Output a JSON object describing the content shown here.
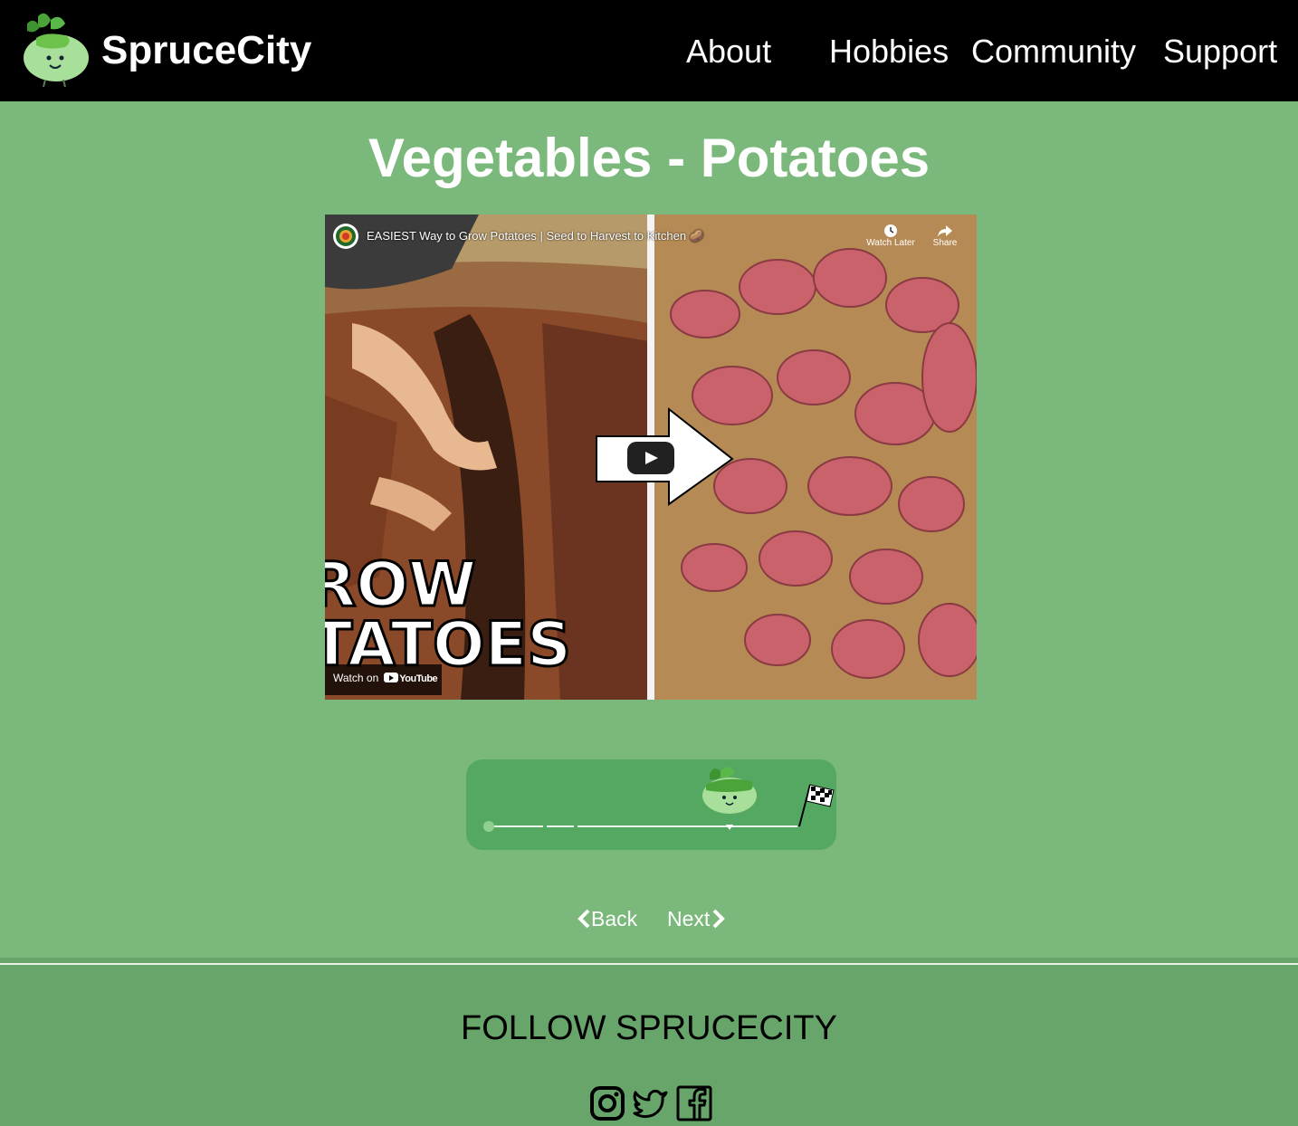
{
  "header": {
    "brand": "SpruceCity",
    "nav": [
      "About",
      "Hobbies",
      "Community",
      "Support"
    ]
  },
  "main": {
    "title": "Vegetables - Potatoes",
    "video": {
      "title": "EASIEST Way to Grow Potatoes | Seed to Harvest to Kitchen 🥔",
      "watch_later": "Watch Later",
      "share": "Share",
      "watch_on": "Watch on",
      "youtube": "YouTube",
      "overlay_line1": "ROW",
      "overlay_line2": "TATOES"
    },
    "progress": {
      "fraction": 0.78
    },
    "back_label": "Back",
    "next_label": "Next"
  },
  "footer": {
    "follow": "FOLLOW SPRUCECITY",
    "icons": [
      "instagram-icon",
      "twitter-icon",
      "facebook-icon"
    ]
  },
  "colors": {
    "page_bg": "#7bb87b",
    "header_bg": "#000000",
    "footer_bg": "#68a56b",
    "progress_bg": "#55a862"
  }
}
